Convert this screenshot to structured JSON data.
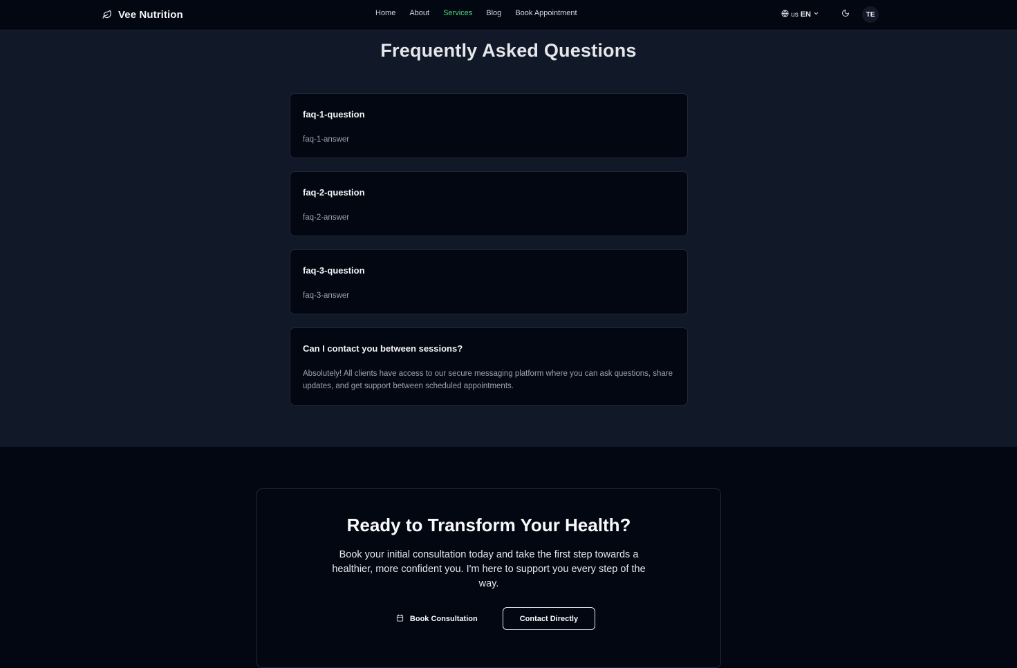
{
  "nav": {
    "brand": "Vee Nutrition",
    "brand_icon": "leaf-icon",
    "links": [
      {
        "label": "Home",
        "active": false
      },
      {
        "label": "About",
        "active": false
      },
      {
        "label": "Services",
        "active": true
      },
      {
        "label": "Blog",
        "active": false
      },
      {
        "label": "Book Appointment",
        "active": false
      }
    ],
    "language": {
      "flag": "us",
      "code": "EN",
      "icon": "globe-icon"
    },
    "theme_icon": "moon-icon",
    "avatar_initials": "TE"
  },
  "faq": {
    "title": "Frequently Asked Questions",
    "items": [
      {
        "question": "faq-1-question",
        "answer": "faq-1-answer"
      },
      {
        "question": "faq-2-question",
        "answer": "faq-2-answer"
      },
      {
        "question": "faq-3-question",
        "answer": "faq-3-answer"
      },
      {
        "question": "Can I contact you between sessions?",
        "answer": "Absolutely! All clients have access to our secure messaging platform where you can ask questions, share updates, and get support between scheduled appointments."
      }
    ]
  },
  "cta": {
    "title": "Ready to Transform Your Health?",
    "text": "Book your initial consultation today and take the first step towards a healthier, more confident you. I'm here to support you every step of the way.",
    "primary_label": "Book Consultation",
    "primary_icon": "calendar-icon",
    "secondary_label": "Contact Directly"
  },
  "colors": {
    "accent": "#4ade80",
    "page_bg": "#111827",
    "card_bg": "#030712"
  }
}
